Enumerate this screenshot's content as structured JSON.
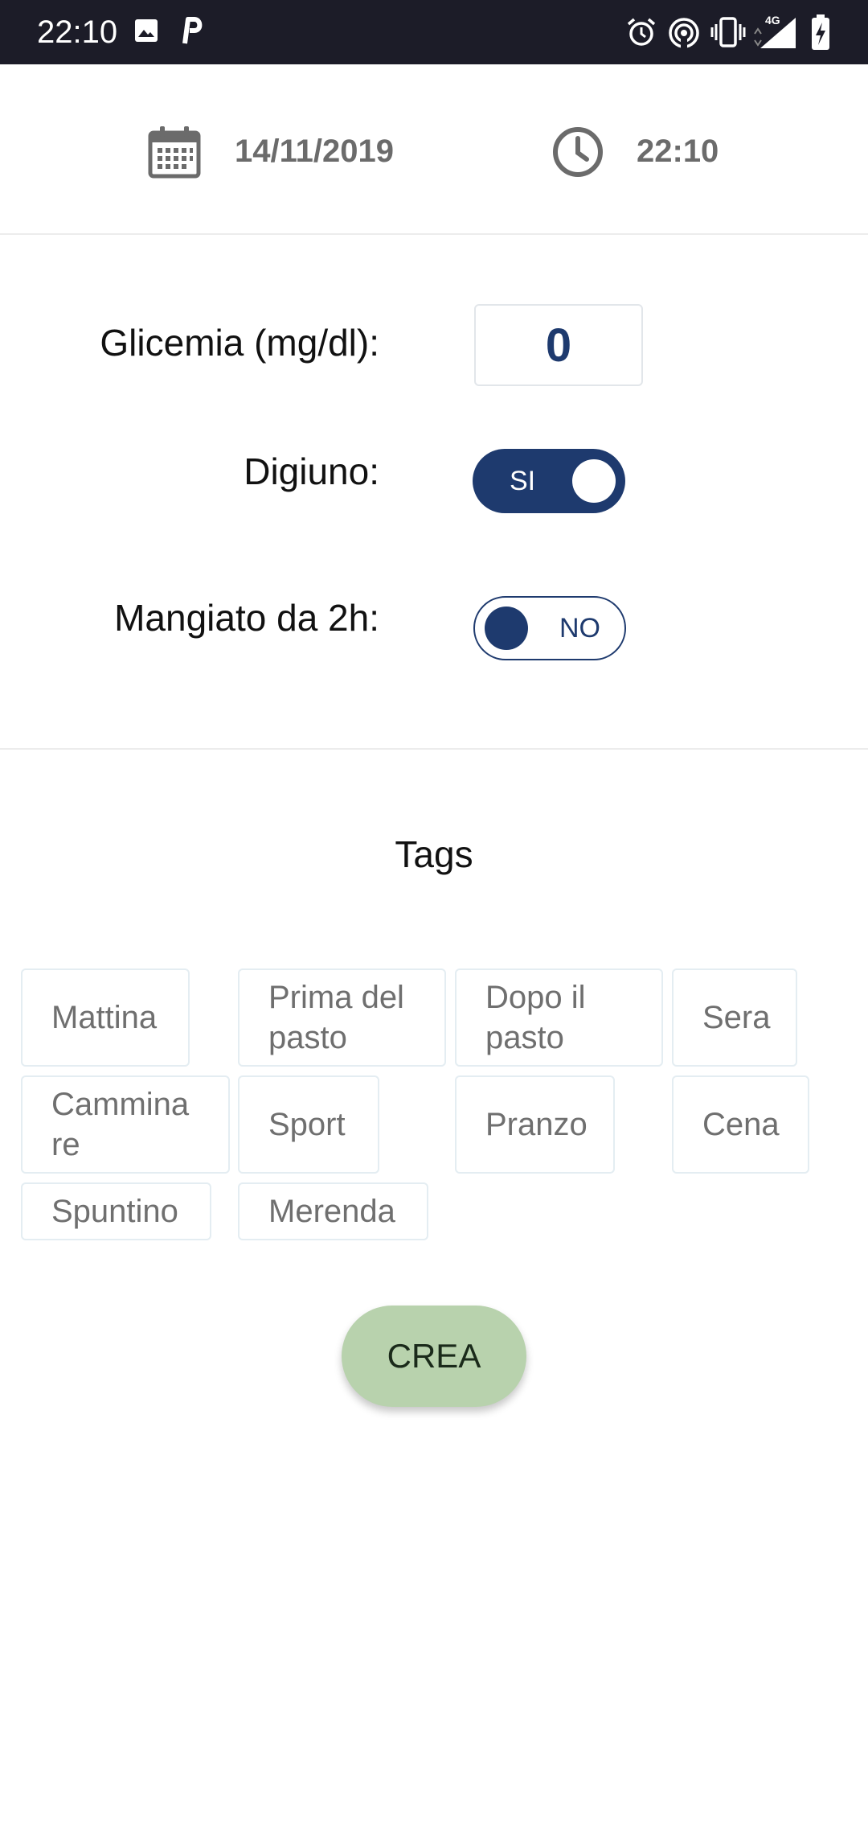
{
  "status_bar": {
    "time": "22:10",
    "icons": [
      "image-icon",
      "p-icon",
      "alarm-icon",
      "hotspot-icon",
      "vibrate-icon",
      "signal-4g-icon",
      "battery-charging-icon"
    ],
    "network_label": "4G"
  },
  "header": {
    "date": "14/11/2019",
    "time": "22:10",
    "date_icon": "calendar-icon",
    "time_icon": "clock-icon"
  },
  "form": {
    "glicemia_label": "Glicemia (mg/dl):",
    "glicemia_value": "0",
    "digiuno_label": "Digiuno:",
    "digiuno_toggle": {
      "state": "on",
      "label": "SI"
    },
    "mangiato_label": "Mangiato da 2h:",
    "mangiato_toggle": {
      "state": "off",
      "label": "NO"
    }
  },
  "tags": {
    "title": "Tags",
    "items": [
      "Mattina",
      "Prima del\npasto",
      "Dopo il\npasto",
      "Sera",
      "Cammina\nre",
      "Sport",
      "Pranzo",
      "Cena",
      "Spuntino",
      "Merenda"
    ]
  },
  "actions": {
    "crea_label": "CREA"
  },
  "colors": {
    "accent": "#1e3a6e",
    "status_bar": "#1c1c28",
    "button": "#b8d2ad"
  }
}
